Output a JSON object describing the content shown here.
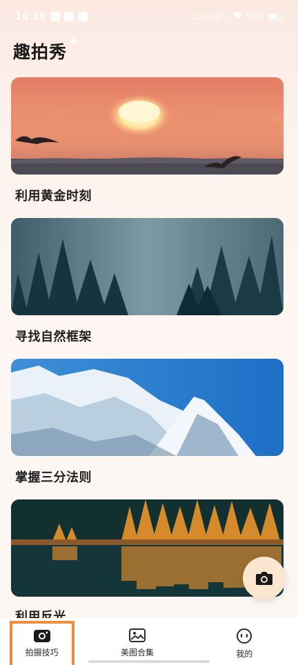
{
  "status_bar": {
    "time": "14:36",
    "network_text": "0.10 KB/S",
    "battery_text": "81%"
  },
  "header": {
    "title": "趣拍秀"
  },
  "cards": [
    {
      "title": "利用黄金时刻",
      "image": "sunset-birds"
    },
    {
      "title": "寻找自然框架",
      "image": "misty-forest"
    },
    {
      "title": "掌握三分法则",
      "image": "snowy-mountains"
    },
    {
      "title": "利用反光",
      "image": "lake-reflection"
    }
  ],
  "bottom_nav": {
    "items": [
      {
        "label": "拍摄技巧",
        "icon": "camera-icon",
        "active": true
      },
      {
        "label": "美图合集",
        "icon": "gallery-icon",
        "active": false
      },
      {
        "label": "我的",
        "icon": "profile-icon",
        "active": false
      }
    ]
  },
  "colors": {
    "accent_orange": "#f08a3c",
    "fab_bg": "#fbe6cf"
  }
}
